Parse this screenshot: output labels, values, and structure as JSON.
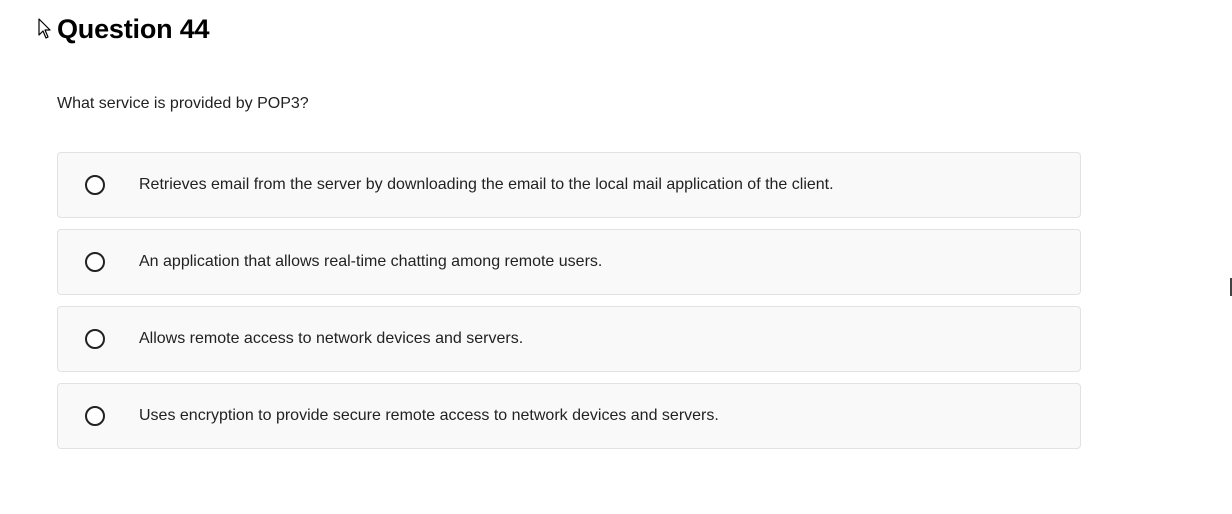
{
  "question": {
    "title": "Question 44",
    "text": "What service is provided by POP3?"
  },
  "options": [
    {
      "label": "Retrieves email from the server by downloading the email to the local mail application of the client.",
      "selected": false
    },
    {
      "label": "An application that allows real-time chatting among remote users.",
      "selected": false
    },
    {
      "label": "Allows remote access to network devices and servers.",
      "selected": false
    },
    {
      "label": "Uses encryption to provide secure remote access to network devices and servers.",
      "selected": false
    }
  ],
  "colors": {
    "option_background": "#f9f9f9",
    "option_border": "#e2e2e2",
    "text": "#222222"
  },
  "icons": {
    "cursor": "mouse-pointer-icon"
  }
}
